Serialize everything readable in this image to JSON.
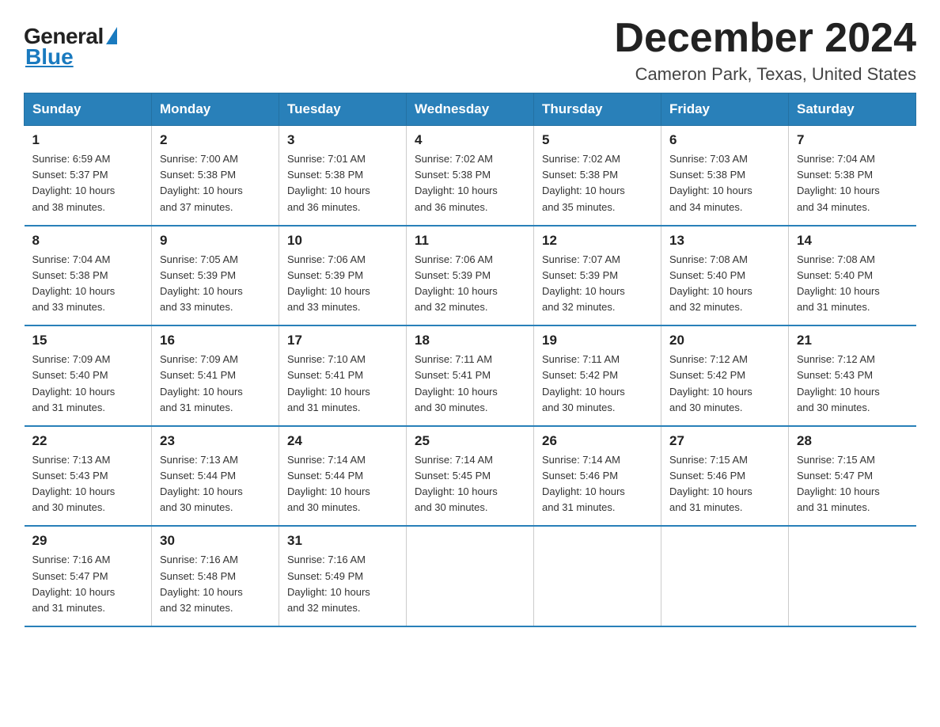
{
  "logo": {
    "general": "General",
    "blue": "Blue"
  },
  "header": {
    "month": "December 2024",
    "location": "Cameron Park, Texas, United States"
  },
  "weekdays": [
    "Sunday",
    "Monday",
    "Tuesday",
    "Wednesday",
    "Thursday",
    "Friday",
    "Saturday"
  ],
  "weeks": [
    [
      {
        "day": "1",
        "sunrise": "6:59 AM",
        "sunset": "5:37 PM",
        "daylight": "10 hours and 38 minutes."
      },
      {
        "day": "2",
        "sunrise": "7:00 AM",
        "sunset": "5:38 PM",
        "daylight": "10 hours and 37 minutes."
      },
      {
        "day": "3",
        "sunrise": "7:01 AM",
        "sunset": "5:38 PM",
        "daylight": "10 hours and 36 minutes."
      },
      {
        "day": "4",
        "sunrise": "7:02 AM",
        "sunset": "5:38 PM",
        "daylight": "10 hours and 36 minutes."
      },
      {
        "day": "5",
        "sunrise": "7:02 AM",
        "sunset": "5:38 PM",
        "daylight": "10 hours and 35 minutes."
      },
      {
        "day": "6",
        "sunrise": "7:03 AM",
        "sunset": "5:38 PM",
        "daylight": "10 hours and 34 minutes."
      },
      {
        "day": "7",
        "sunrise": "7:04 AM",
        "sunset": "5:38 PM",
        "daylight": "10 hours and 34 minutes."
      }
    ],
    [
      {
        "day": "8",
        "sunrise": "7:04 AM",
        "sunset": "5:38 PM",
        "daylight": "10 hours and 33 minutes."
      },
      {
        "day": "9",
        "sunrise": "7:05 AM",
        "sunset": "5:39 PM",
        "daylight": "10 hours and 33 minutes."
      },
      {
        "day": "10",
        "sunrise": "7:06 AM",
        "sunset": "5:39 PM",
        "daylight": "10 hours and 33 minutes."
      },
      {
        "day": "11",
        "sunrise": "7:06 AM",
        "sunset": "5:39 PM",
        "daylight": "10 hours and 32 minutes."
      },
      {
        "day": "12",
        "sunrise": "7:07 AM",
        "sunset": "5:39 PM",
        "daylight": "10 hours and 32 minutes."
      },
      {
        "day": "13",
        "sunrise": "7:08 AM",
        "sunset": "5:40 PM",
        "daylight": "10 hours and 32 minutes."
      },
      {
        "day": "14",
        "sunrise": "7:08 AM",
        "sunset": "5:40 PM",
        "daylight": "10 hours and 31 minutes."
      }
    ],
    [
      {
        "day": "15",
        "sunrise": "7:09 AM",
        "sunset": "5:40 PM",
        "daylight": "10 hours and 31 minutes."
      },
      {
        "day": "16",
        "sunrise": "7:09 AM",
        "sunset": "5:41 PM",
        "daylight": "10 hours and 31 minutes."
      },
      {
        "day": "17",
        "sunrise": "7:10 AM",
        "sunset": "5:41 PM",
        "daylight": "10 hours and 31 minutes."
      },
      {
        "day": "18",
        "sunrise": "7:11 AM",
        "sunset": "5:41 PM",
        "daylight": "10 hours and 30 minutes."
      },
      {
        "day": "19",
        "sunrise": "7:11 AM",
        "sunset": "5:42 PM",
        "daylight": "10 hours and 30 minutes."
      },
      {
        "day": "20",
        "sunrise": "7:12 AM",
        "sunset": "5:42 PM",
        "daylight": "10 hours and 30 minutes."
      },
      {
        "day": "21",
        "sunrise": "7:12 AM",
        "sunset": "5:43 PM",
        "daylight": "10 hours and 30 minutes."
      }
    ],
    [
      {
        "day": "22",
        "sunrise": "7:13 AM",
        "sunset": "5:43 PM",
        "daylight": "10 hours and 30 minutes."
      },
      {
        "day": "23",
        "sunrise": "7:13 AM",
        "sunset": "5:44 PM",
        "daylight": "10 hours and 30 minutes."
      },
      {
        "day": "24",
        "sunrise": "7:14 AM",
        "sunset": "5:44 PM",
        "daylight": "10 hours and 30 minutes."
      },
      {
        "day": "25",
        "sunrise": "7:14 AM",
        "sunset": "5:45 PM",
        "daylight": "10 hours and 30 minutes."
      },
      {
        "day": "26",
        "sunrise": "7:14 AM",
        "sunset": "5:46 PM",
        "daylight": "10 hours and 31 minutes."
      },
      {
        "day": "27",
        "sunrise": "7:15 AM",
        "sunset": "5:46 PM",
        "daylight": "10 hours and 31 minutes."
      },
      {
        "day": "28",
        "sunrise": "7:15 AM",
        "sunset": "5:47 PM",
        "daylight": "10 hours and 31 minutes."
      }
    ],
    [
      {
        "day": "29",
        "sunrise": "7:16 AM",
        "sunset": "5:47 PM",
        "daylight": "10 hours and 31 minutes."
      },
      {
        "day": "30",
        "sunrise": "7:16 AM",
        "sunset": "5:48 PM",
        "daylight": "10 hours and 32 minutes."
      },
      {
        "day": "31",
        "sunrise": "7:16 AM",
        "sunset": "5:49 PM",
        "daylight": "10 hours and 32 minutes."
      },
      null,
      null,
      null,
      null
    ]
  ],
  "labels": {
    "sunrise": "Sunrise:",
    "sunset": "Sunset:",
    "daylight": "Daylight:"
  }
}
